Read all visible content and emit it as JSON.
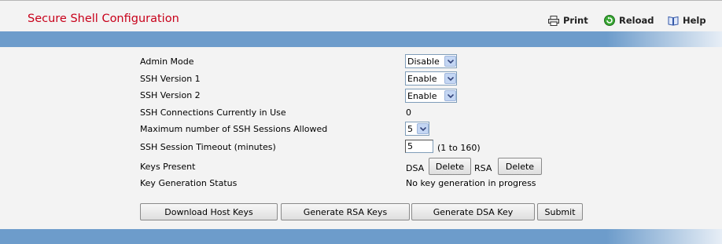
{
  "page": {
    "title": "Secure Shell Configuration"
  },
  "toolbar": {
    "print_label": "Print",
    "reload_label": "Reload",
    "help_label": "Help"
  },
  "form": {
    "admin_mode": {
      "label": "Admin Mode",
      "value": "Disable"
    },
    "ssh_v1": {
      "label": "SSH Version 1",
      "value": "Enable"
    },
    "ssh_v2": {
      "label": "SSH Version 2",
      "value": "Enable"
    },
    "connections": {
      "label": "SSH Connections Currently in Use",
      "value": "0"
    },
    "max_sessions": {
      "label": "Maximum number of SSH Sessions Allowed",
      "value": "5"
    },
    "timeout": {
      "label": "SSH Session Timeout (minutes)",
      "value": "5",
      "hint": "(1 to 160)"
    },
    "keys_present": {
      "label": "Keys Present",
      "dsa_label": "DSA",
      "rsa_label": "RSA",
      "delete_label": "Delete"
    },
    "key_gen_status": {
      "label": "Key Generation Status",
      "value": "No key generation in progress"
    }
  },
  "actions": {
    "download_host_keys": "Download Host Keys",
    "generate_rsa": "Generate RSA Keys",
    "generate_dsa": "Generate DSA Key",
    "submit": "Submit"
  },
  "colors": {
    "title": "#c8001a",
    "band": "#6d9ccb"
  }
}
